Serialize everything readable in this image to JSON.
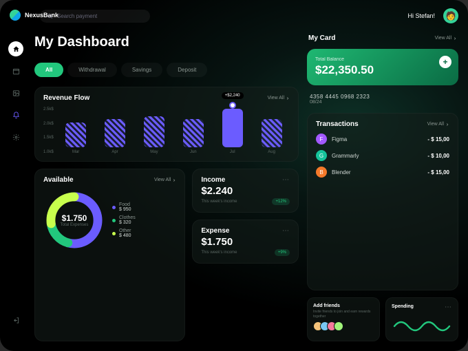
{
  "brand": "NexusBank",
  "search": {
    "placeholder": "Search payment"
  },
  "greeting": "Hi Stefan!",
  "avatar_emoji": "🧑",
  "page_title": "My Dashboard",
  "tabs": {
    "all": "All",
    "withdrawal": "Withdrawal",
    "savings": "Savings",
    "deposit": "Deposit"
  },
  "viewall_label": "View All",
  "revenue": {
    "title": "Revenue Flow",
    "tooltip": "+$2,240",
    "yticks": [
      "2.5k$",
      "2.0k$",
      "1.5k$",
      "1.0k$"
    ]
  },
  "chart_data": {
    "type": "bar",
    "title": "Revenue Flow",
    "categories": [
      "Mar",
      "Apr",
      "May",
      "Jun",
      "Jul",
      "Aug"
    ],
    "values": [
      1800,
      1900,
      2000,
      1900,
      2240,
      1900
    ],
    "highlight_index": 4,
    "ylim": [
      1000,
      2500
    ],
    "ylabel": "$"
  },
  "available": {
    "title": "Available",
    "center_value": "$1.750",
    "center_label": "Total Expenses",
    "legend": [
      {
        "label": "Food",
        "value": "$ 950",
        "color": "#6b5cff"
      },
      {
        "label": "Clothes",
        "value": "$ 320",
        "color": "#22c77d"
      },
      {
        "label": "Other",
        "value": "$ 480",
        "color": "#c8ff4d"
      }
    ],
    "donut_values": [
      950,
      320,
      480
    ]
  },
  "income": {
    "title": "Income",
    "value": "$2.240",
    "sub": "This week's income",
    "pill": "+12%"
  },
  "expense": {
    "title": "Expense",
    "value": "$1.750",
    "sub": "This week's income",
    "pill": "+9%"
  },
  "mycard": {
    "title": "My Card",
    "balance_label": "Total Balance",
    "balance": "$22,350.50",
    "number": "4358 4445 0968 2323",
    "exp": "08/24"
  },
  "transactions": {
    "title": "Transactions",
    "items": [
      {
        "name": "Figma",
        "amount": "- $ 15,00",
        "color": "#a259ff"
      },
      {
        "name": "Grammarly",
        "amount": "- $ 10,00",
        "color": "#15c39a"
      },
      {
        "name": "Blender",
        "amount": "- $ 15,00",
        "color": "#f5792a"
      }
    ]
  },
  "add_friends": {
    "title": "Add friends",
    "sub": "Invite friends to join and earn rewards together"
  },
  "spending": {
    "title": "Spending"
  },
  "colors": {
    "accent": "#22c77d",
    "violet": "#6b5cff",
    "lime": "#c8ff4d"
  }
}
